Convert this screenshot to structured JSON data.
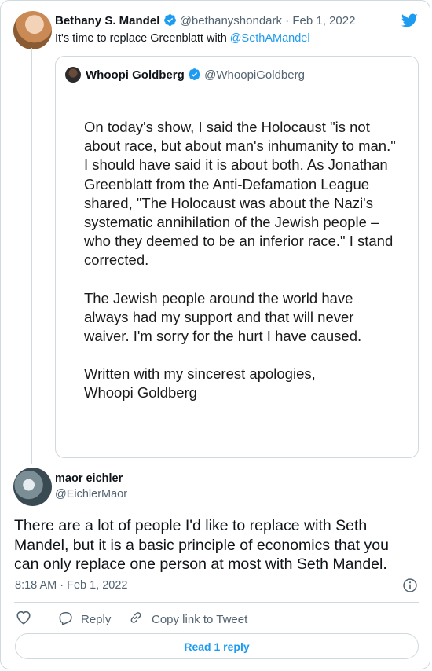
{
  "parent_tweet": {
    "author_name": "Bethany S. Mandel",
    "handle": "@bethanyshondark",
    "separator": " · ",
    "date": "Feb 1, 2022",
    "text_prefix": "It's time to replace Greenblatt with ",
    "mention": "@SethAMandel"
  },
  "quoted_tweet": {
    "author_name": "Whoopi Goldberg",
    "handle": "@WhoopiGoldberg",
    "image_paragraphs": [
      "On today's show, I said the Holocaust \"is not about race, but about man's inhumanity to man.\" I should have said it is about both. As Jonathan Greenblatt from the Anti-Defamation League shared, \"The Holocaust was about the Nazi's systematic annihilation of the Jewish people – who they deemed to be an inferior race.\" I stand corrected.",
      "The Jewish people around the world have always had my support and that will never waiver. I'm sorry for the hurt I have caused.",
      "Written with my sincerest apologies,\nWhoopi Goldberg"
    ]
  },
  "reply_tweet": {
    "author_name": "maor eichler",
    "handle": "@EichlerMaor",
    "text": "There are a lot of people I'd like to replace with Seth Mandel, but it is a basic principle of economics that you can only replace one person at most with Seth Mandel.",
    "time": "8:18 AM · Feb 1, 2022"
  },
  "actions": {
    "reply_label": "Reply",
    "copy_link_label": "Copy link to Tweet",
    "read_replies_label": "Read 1 reply"
  },
  "colors": {
    "accent": "#1d9bf0",
    "text": "#0f1419",
    "muted": "#536471",
    "border": "#cfd9de"
  }
}
